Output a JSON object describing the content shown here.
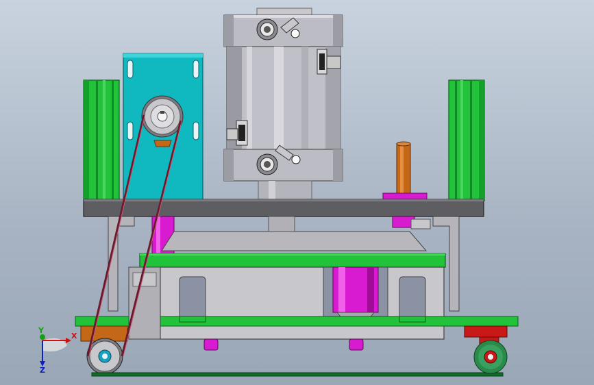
{
  "viewport": {
    "background_top": "#c9d3df",
    "background_bottom": "#9aa7b6"
  },
  "colors": {
    "frame_green": "#22c23a",
    "frame_green_dark": "#0e8c24",
    "mount_plate_cyan": "#10b8c0",
    "motor_body_gray": "#c0c0c8",
    "base_plate_dark": "#5e5e62",
    "steel_gray": "#b4b4b8",
    "magenta_post": "#d81ad0",
    "copper_pin": "#c46818",
    "belt_red": "#6a1a2c",
    "caster_red": "#c81818",
    "axis_x": "#d01010",
    "axis_y": "#10a010",
    "axis_z": "#1020c0"
  },
  "triad": {
    "x_label": "X",
    "y_label": "Y",
    "z_label": "Z"
  }
}
